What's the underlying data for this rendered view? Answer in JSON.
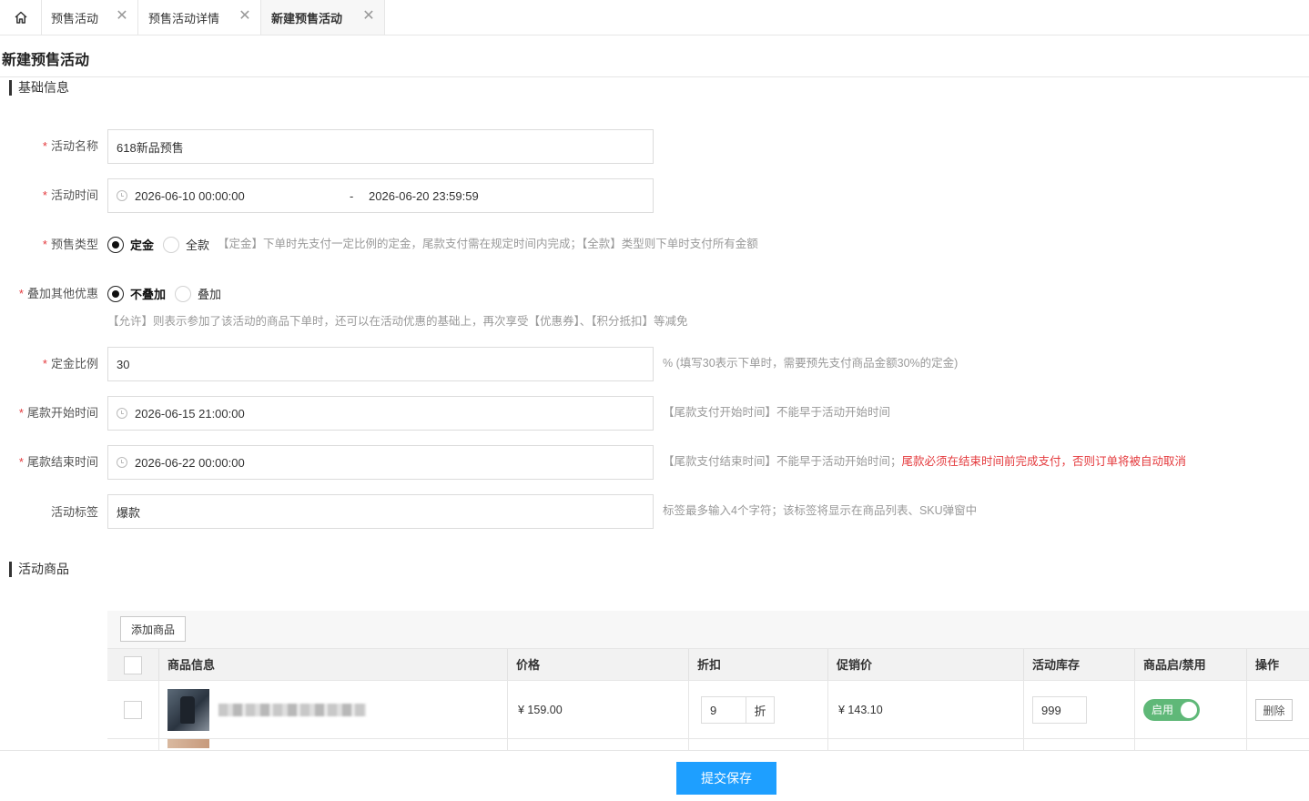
{
  "tabs": {
    "home_icon": "home-icon",
    "items": [
      {
        "label": "预售活动"
      },
      {
        "label": "预售活动详情"
      },
      {
        "label": "新建预售活动"
      }
    ],
    "close_glyph": "✕"
  },
  "page": {
    "title": "新建预售活动"
  },
  "sections": {
    "basic": "基础信息",
    "products": "活动商品"
  },
  "form": {
    "required_mark": "*",
    "name": {
      "label": "活动名称",
      "value": "618新品预售"
    },
    "time": {
      "label": "活动时间",
      "start": "2026-06-10 00:00:00",
      "separator": "-",
      "end": "2026-06-20 23:59:59"
    },
    "presale_type": {
      "label": "预售类型",
      "options": [
        "定金",
        "全款"
      ],
      "selected": "定金",
      "hint": "【定金】下单时先支付一定比例的定金，尾款支付需在规定时间内完成；【全款】类型则下单时支付所有金额"
    },
    "stack": {
      "label": "叠加其他优惠",
      "options": [
        "不叠加",
        "叠加"
      ],
      "selected": "不叠加",
      "hint": "【允许】则表示参加了该活动的商品下单时，还可以在活动优惠的基础上，再次享受【优惠券】、【积分抵扣】等减免"
    },
    "deposit_ratio": {
      "label": "定金比例",
      "value": "30",
      "hint": "% (填写30表示下单时，需要预先支付商品金额30%的定金)"
    },
    "final_start": {
      "label": "尾款开始时间",
      "value": "2026-06-15 21:00:00",
      "hint": "【尾款支付开始时间】不能早于活动开始时间"
    },
    "final_end": {
      "label": "尾款结束时间",
      "value": "2026-06-22 00:00:00",
      "hint": "【尾款支付结束时间】不能早于活动开始时间；",
      "warning": "尾款必须在结束时间前完成支付，否则订单将被自动取消"
    },
    "tag": {
      "label": "活动标签",
      "value": "爆款",
      "hint": "标签最多输入4个字符；该标签将显示在商品列表、SKU弹窗中"
    }
  },
  "products": {
    "add_button": "添加商品",
    "columns": [
      "商品信息",
      "价格",
      "折扣",
      "促销价",
      "活动库存",
      "商品启/禁用",
      "操作"
    ],
    "rows": [
      {
        "price": "¥ 159.00",
        "discount": "9",
        "discount_unit": "折",
        "promo_price": "¥ 143.10",
        "stock": "999",
        "enabled_label": "启用",
        "enabled": true,
        "delete_label": "删除"
      }
    ]
  },
  "footer": {
    "submit": "提交保存"
  },
  "colors": {
    "primary": "#1e9fff",
    "toggle_on": "#5fb878",
    "required": "#e4393c"
  }
}
